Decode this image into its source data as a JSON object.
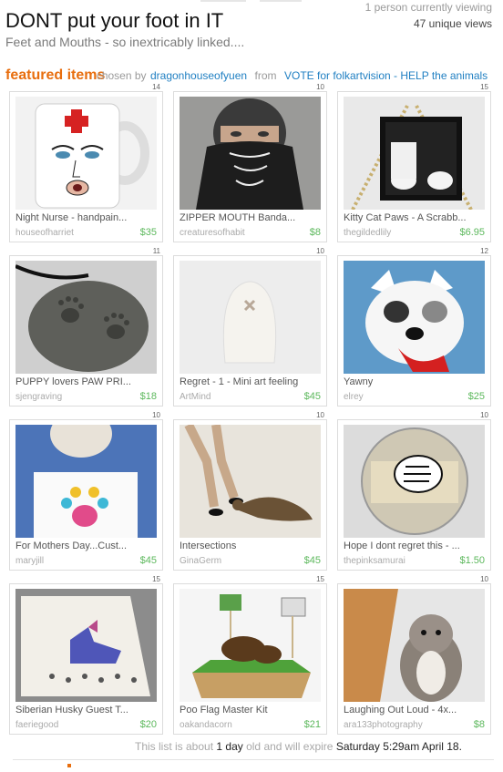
{
  "header": {
    "title": "DONT put your foot in IT",
    "subtitle": "Feet and Mouths - so inextricably linked....",
    "viewing": "1 person currently viewing",
    "views": "47 unique views"
  },
  "featured": {
    "label": "featured items",
    "chosen_by": "chosen by",
    "curator": "dragonhouseofyuen",
    "from": "from",
    "source": "VOTE for folkartvision - HELP the animals"
  },
  "items": [
    {
      "num": "14",
      "name": "Night Nurse -  handpain...",
      "shop": "houseofharriet",
      "price": "$35",
      "icon": "mug-image"
    },
    {
      "num": "10",
      "name": "ZIPPER MOUTH Banda...",
      "shop": "creaturesofhabit",
      "price": "$8",
      "icon": "bandana-image"
    },
    {
      "num": "15",
      "name": "Kitty Cat Paws - A Scrabb...",
      "shop": "thegildedlily",
      "price": "$6.95",
      "icon": "pendant-image"
    },
    {
      "num": "11",
      "name": "PUPPY lovers PAW PRI...",
      "shop": "sjengraving",
      "price": "$18",
      "icon": "stone-image"
    },
    {
      "num": "10",
      "name": "Regret - 1 -  Mini art feeling",
      "shop": "ArtMind",
      "price": "$45",
      "icon": "figure-image"
    },
    {
      "num": "12",
      "name": "Yawny",
      "shop": "elrey",
      "price": "$25",
      "icon": "dog-image"
    },
    {
      "num": "10",
      "name": "For Mothers Day...Cust...",
      "shop": "maryjill",
      "price": "$45",
      "icon": "paw-card-image"
    },
    {
      "num": "10",
      "name": "Intersections",
      "shop": "GinaGerm",
      "price": "$45",
      "icon": "otter-image"
    },
    {
      "num": "10",
      "name": "Hope I dont regret this - ...",
      "shop": "thepinksamurai",
      "price": "$1.50",
      "icon": "button-image"
    },
    {
      "num": "15",
      "name": "Siberian Husky Guest T...",
      "shop": "faeriegood",
      "price": "$20",
      "icon": "towel-image"
    },
    {
      "num": "15",
      "name": "Poo Flag Master Kit",
      "shop": "oakandacorn",
      "price": "$21",
      "icon": "box-image"
    },
    {
      "num": "10",
      "name": "Laughing Out Loud - 4x...",
      "shop": "ara133photography",
      "price": "$8",
      "icon": "squirrel-image"
    }
  ],
  "footer": {
    "pre": "This list is about",
    "age": "1 day",
    "mid": "old and will expire",
    "expire": "Saturday 5:29am  April 18."
  },
  "colors": {
    "accent": "#e86e0e",
    "link": "#1f7fc2",
    "price": "#5cb85c"
  }
}
